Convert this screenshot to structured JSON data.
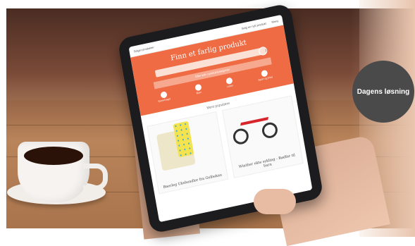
{
  "tablet_screen": {
    "nav_left": "Selger produkter",
    "nav_links": [
      "Selg en nytt produkt",
      "Meny"
    ],
    "hero_title": "Finn et farlig produkt",
    "alt_search_label": "Eller søk i produktkategorier",
    "categories": [
      "Barnehager",
      "Barn",
      "Leker",
      "Sport og fritid"
    ],
    "popular_label": "Mest populære",
    "products": [
      {
        "name": "Baerleg Ukshendler fra Gelbekau"
      },
      {
        "name": "Winther ekte sykling - Rødfar til barn"
      }
    ]
  },
  "badge": {
    "label": "Dagens løsning",
    "color": "#4a4a4a"
  },
  "colors": {
    "accent": "#ee6b44"
  }
}
